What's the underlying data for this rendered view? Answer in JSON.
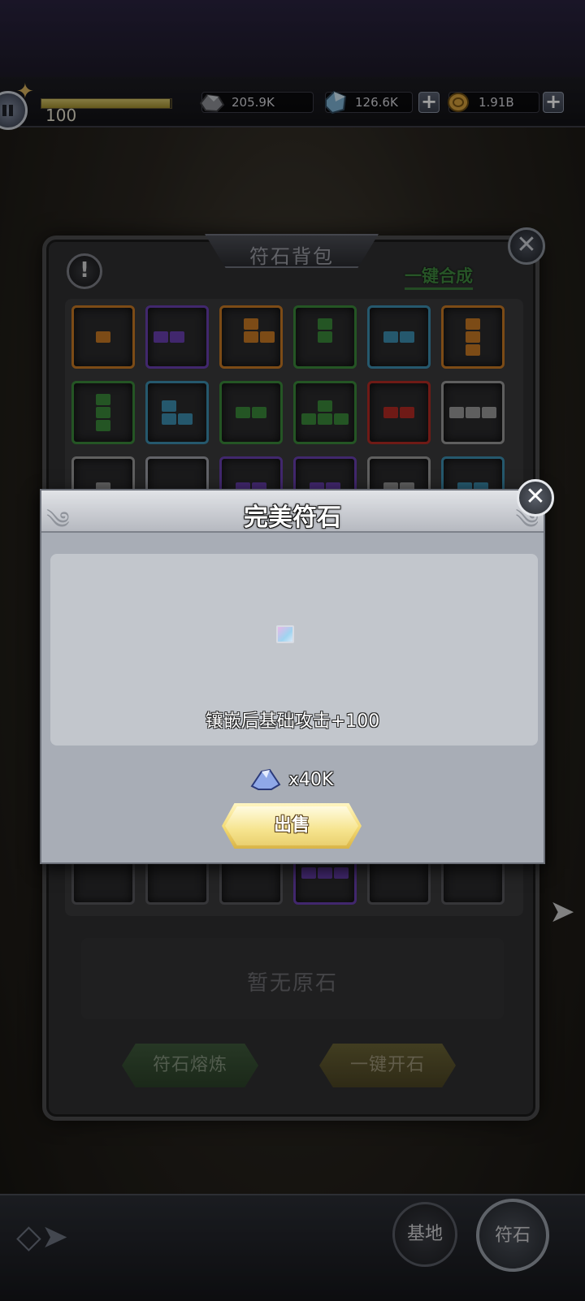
{
  "top_bar": {
    "level": "100",
    "exp_fraction": 0.99,
    "resources": [
      {
        "name": "ore",
        "icon": "ore-icon",
        "value": "205.9K"
      },
      {
        "name": "crystal",
        "icon": "crystal-icon",
        "value": "126.6K"
      },
      {
        "name": "gold",
        "icon": "gold-coin-icon",
        "value": "1.91B"
      }
    ]
  },
  "rune_bag": {
    "title": "符石背包",
    "one_click_compose": "一键合成",
    "no_raw_stone": "暂无原石",
    "smelt_button": "符石熔炼",
    "open_stone_button": "一键开石",
    "slot_colors": {
      "orange": "#c97a24",
      "purple": "#6a3fb0",
      "green": "#3a8a3a",
      "blue": "#3d8eb0",
      "red": "#b32a24",
      "gray": "#9a9a9a"
    }
  },
  "modal": {
    "title": "完美符石",
    "effect": "镶嵌后基础攻击+100",
    "price": "x40K",
    "sell_button": "出售"
  },
  "bottom_nav": {
    "base": "基地",
    "rune": "符石"
  }
}
